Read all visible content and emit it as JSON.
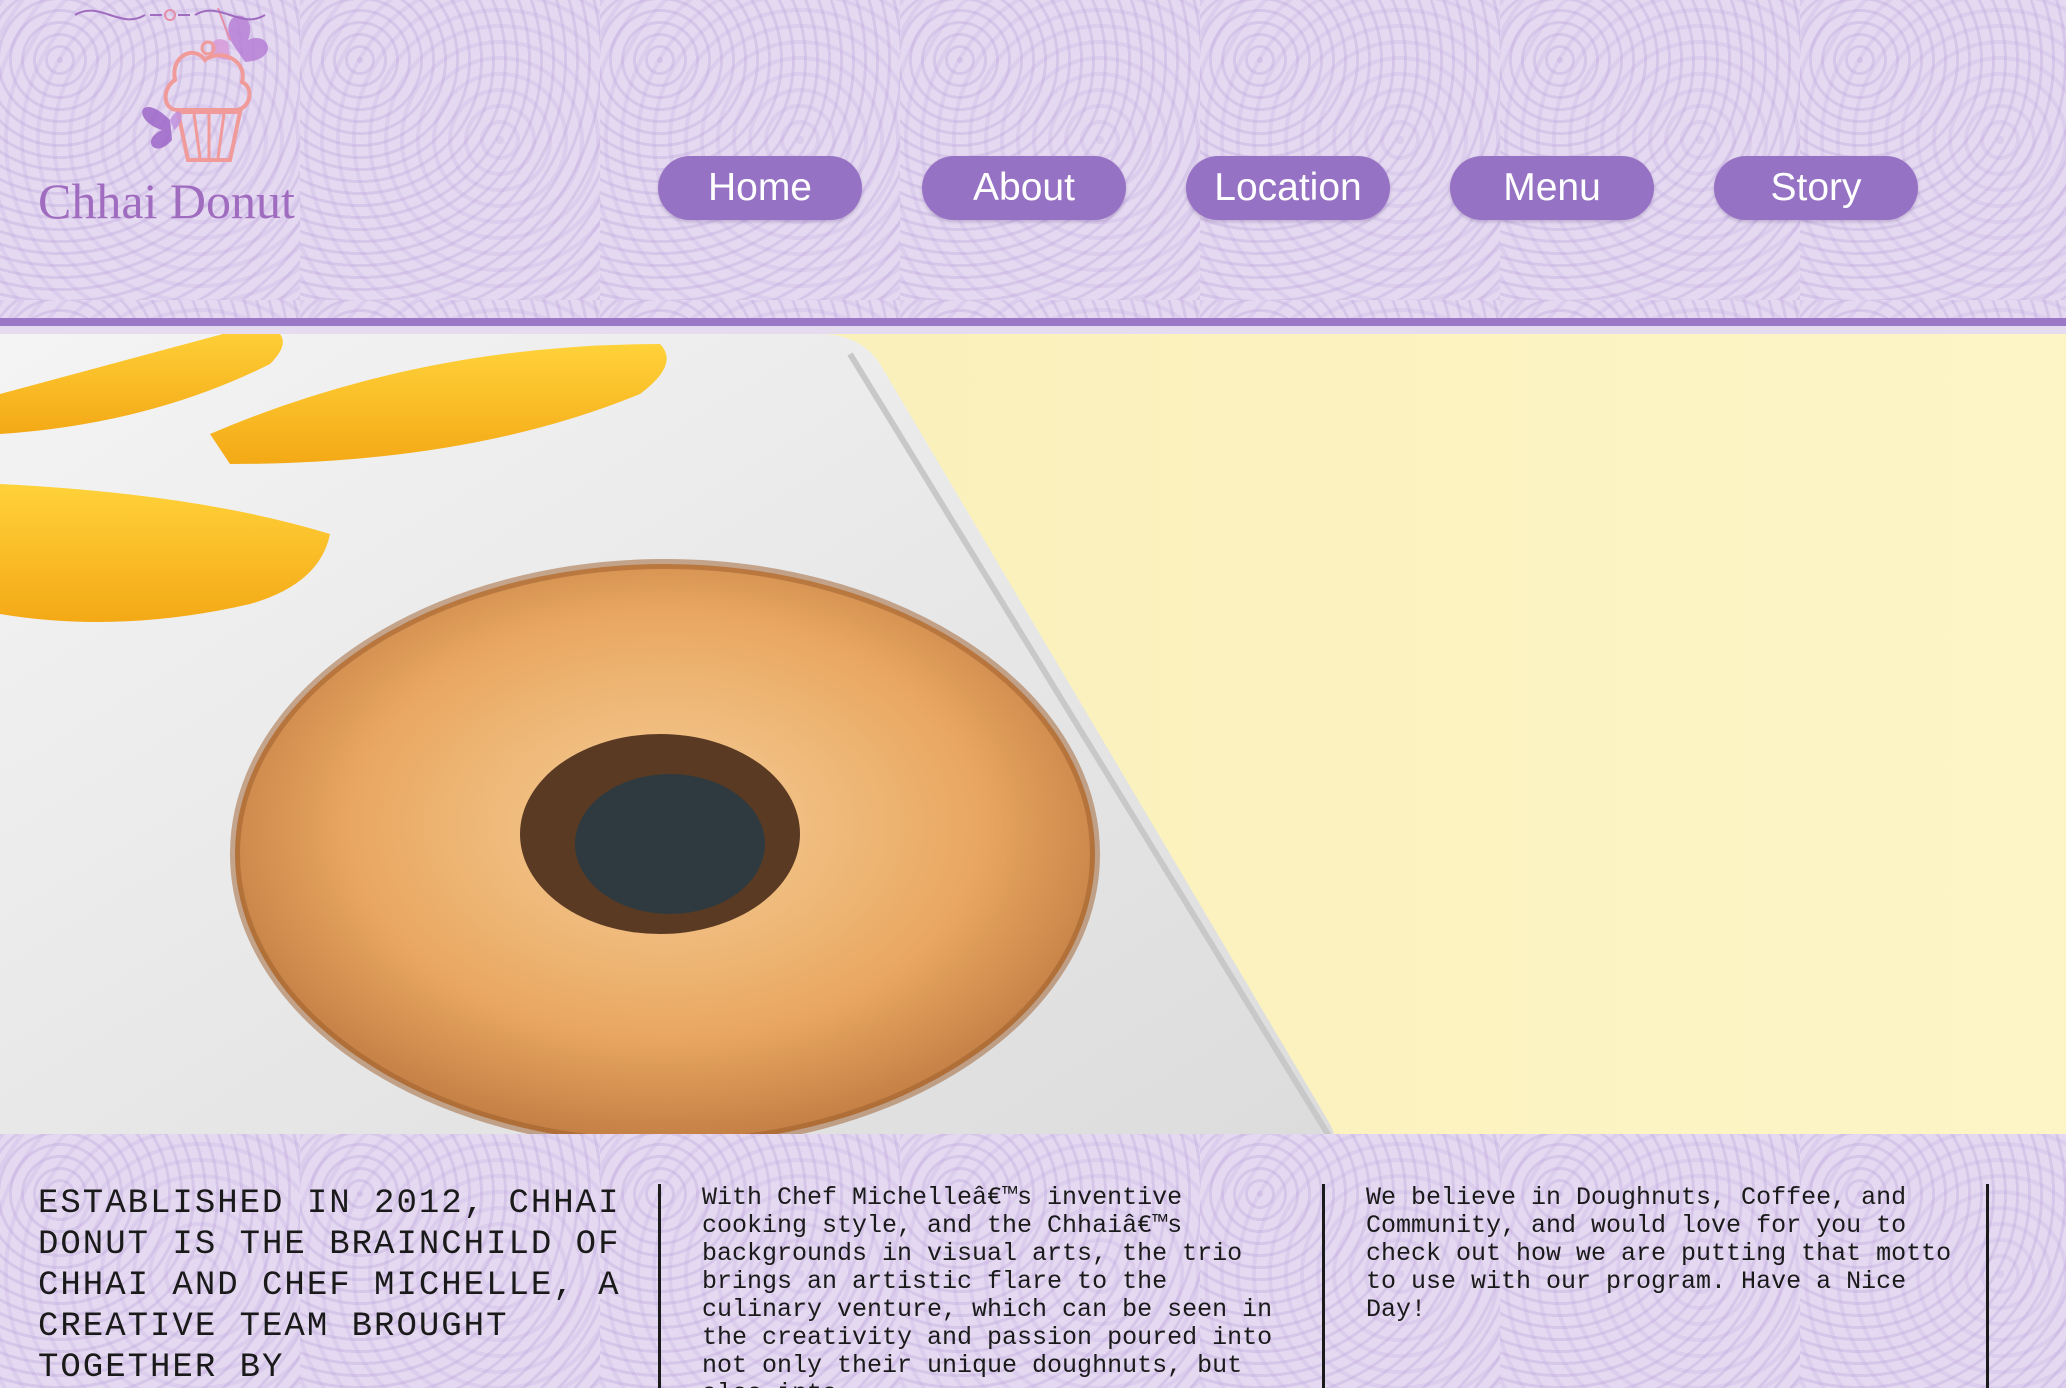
{
  "brand": {
    "name": "Chhai Donut",
    "logo_icon": "cupcake-butterfly-logo"
  },
  "nav": {
    "items": [
      {
        "label": "Home"
      },
      {
        "label": "About"
      },
      {
        "label": "Location"
      },
      {
        "label": "Menu"
      },
      {
        "label": "Story"
      }
    ]
  },
  "hero": {
    "image": "glazed-lemon-donut-photo"
  },
  "info": {
    "col1": "Established in 2012, Chhai Donut is the brainchild of Chhai and Chef Michelle, a creative team brought together by",
    "col2": "With Chef Michelleâ€™s inventive cooking style, and the Chhaiâ€™s backgrounds in visual arts, the trio brings an artistic flare to the culinary venture, which can be seen in the creativity and passion poured into not only their unique doughnuts, but also into",
    "col3": "We believe in Doughnuts, Coffee, and Community, and would love for you to check out how we are putting that motto to use with our program. Have a Nice Day!"
  },
  "colors": {
    "accent": "#9672c4",
    "header_bg": "#e4d9f0",
    "hero_bg": "#fbf2bf"
  }
}
